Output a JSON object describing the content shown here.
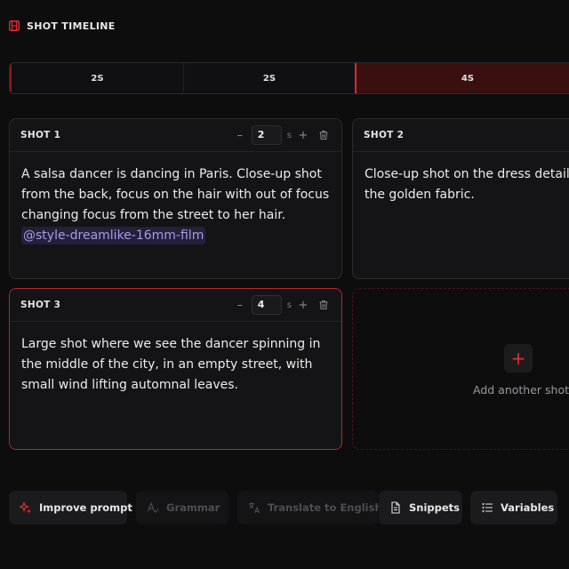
{
  "header": {
    "title": "SHOT TIMELINE",
    "icon": "film-icon"
  },
  "timeline": {
    "segments": [
      {
        "label": "2S"
      },
      {
        "label": "2S"
      },
      {
        "label": "4S",
        "selected": true
      }
    ]
  },
  "shots": [
    {
      "title": "SHOT 1",
      "duration": "2",
      "unit": "s",
      "text": "A salsa dancer is dancing in Paris. Close-up shot from the back, focus on the hair with out of focus changing focus from the street to her hair.",
      "tag": "@style-dreamlike-16mm-film"
    },
    {
      "title": "SHOT 2",
      "text": "Close-up shot on the dress details, s the golden fabric."
    },
    {
      "title": "SHOT 3",
      "duration": "4",
      "unit": "s",
      "selected": true,
      "text": "Large shot where we see the dancer spinning in the middle of the city, in an empty street, with small wind lifting automnal leaves."
    }
  ],
  "controls": {
    "minus": "–",
    "plus": "+"
  },
  "add_shot": {
    "label": "Add another shot",
    "icon": "+"
  },
  "toolbar": {
    "improve": "Improve prompt",
    "grammar": "Grammar",
    "translate": "Translate to English",
    "snippets": "Snippets",
    "variables": "Variables"
  },
  "colors": {
    "accent": "#e03030",
    "tag_bg": "#24203a",
    "tag_text": "#a89be8",
    "background": "#0d0d0e"
  }
}
